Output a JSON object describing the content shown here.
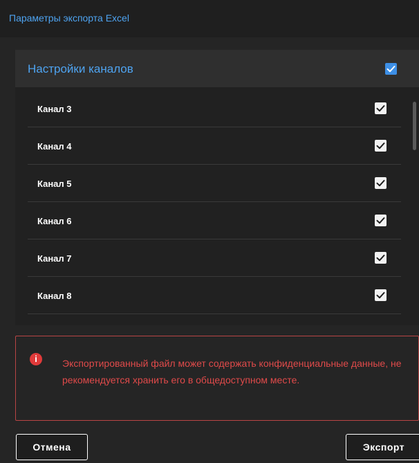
{
  "dialog": {
    "title": "Параметры экспорта Excel"
  },
  "panel": {
    "title": "Настройки каналов",
    "select_all_checked": true,
    "channels": [
      {
        "label": "Канал 3",
        "checked": true
      },
      {
        "label": "Канал 4",
        "checked": true
      },
      {
        "label": "Канал 5",
        "checked": true
      },
      {
        "label": "Канал 6",
        "checked": true
      },
      {
        "label": "Канал 7",
        "checked": true
      },
      {
        "label": "Канал 8",
        "checked": true
      }
    ]
  },
  "alert": {
    "icon": "info-icon",
    "text": "Экспортированный файл может содержать конфиденциальные данные, не рекомендуется хранить его в общедоступном месте."
  },
  "buttons": {
    "cancel": "Отмена",
    "export": "Экспорт"
  },
  "colors": {
    "accent": "#4ea3f0",
    "checkbox_header": "#3d8fe6",
    "warning": "#e04a4a"
  }
}
